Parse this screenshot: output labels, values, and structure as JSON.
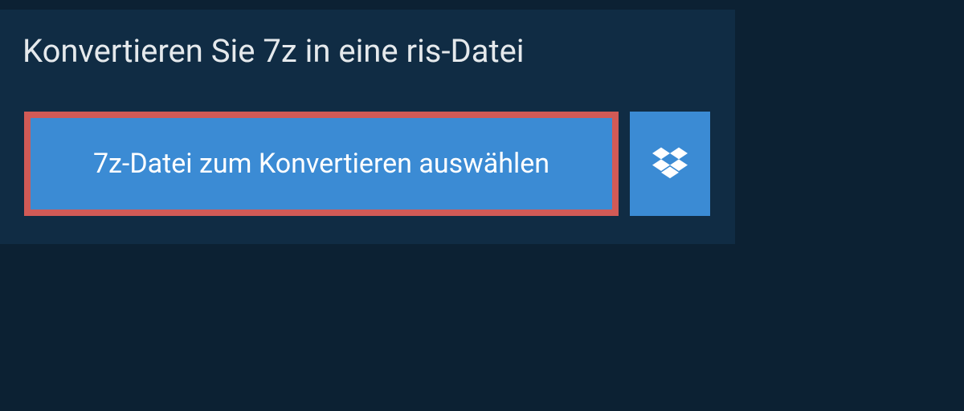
{
  "header": {
    "title": "Konvertieren Sie 7z in eine ris-Datei"
  },
  "actions": {
    "select_file_label": "7z-Datei zum Konvertieren auswählen"
  },
  "colors": {
    "page_bg": "#0c2133",
    "panel_bg": "#102c44",
    "button_bg": "#3b8bd4",
    "highlight_border": "#d15a56",
    "text": "#e5e9ec"
  }
}
